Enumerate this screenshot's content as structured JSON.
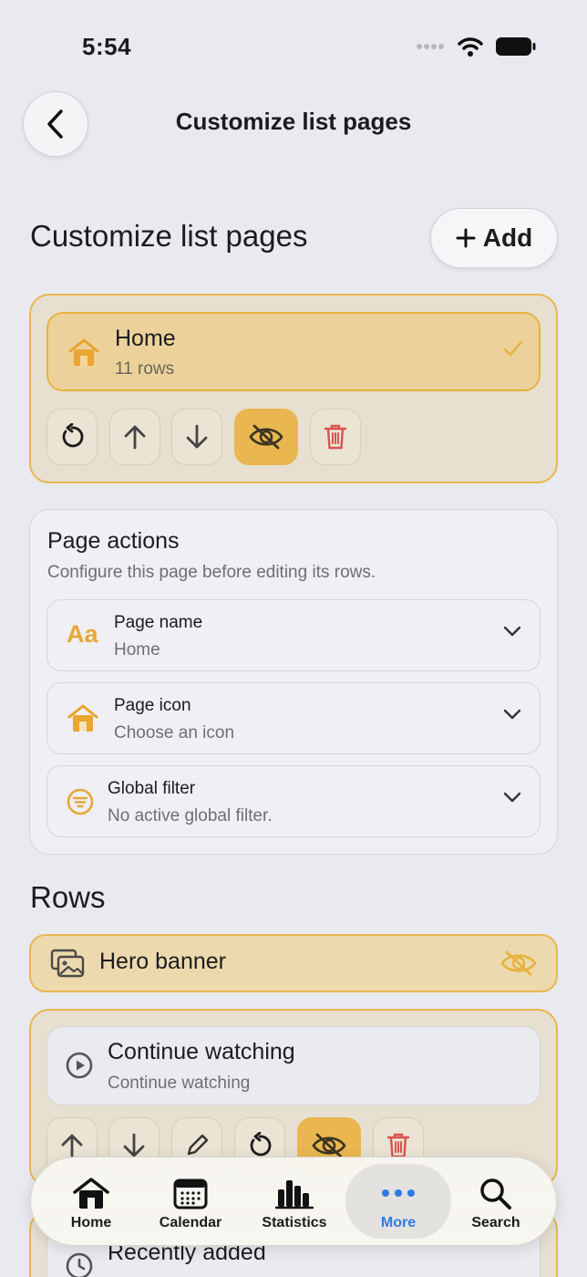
{
  "status_bar": {
    "time": "5:54"
  },
  "header": {
    "back_icon": "chevron-left-icon",
    "title": "Customize list pages"
  },
  "section": {
    "title": "Customize list pages",
    "add_label": "Add"
  },
  "page": {
    "name": "Home",
    "rows_count": "11 rows",
    "icon": "house-icon",
    "selected": true,
    "tools": [
      "reset-icon",
      "arrow-up-icon",
      "arrow-down-icon",
      "eye-slash-icon",
      "trash-icon"
    ],
    "hidden_active": true
  },
  "page_actions": {
    "title": "Page actions",
    "subtitle": "Configure this page before editing its rows.",
    "items": [
      {
        "label": "Page name",
        "value": "Home",
        "icon": "text-aa-icon",
        "icon_text": "Aa"
      },
      {
        "label": "Page icon",
        "value": "Choose an icon",
        "icon": "house-icon"
      },
      {
        "label": "Global filter",
        "value": "No active global filter.",
        "icon": "filter-circle-icon"
      }
    ]
  },
  "rows": {
    "title": "Rows",
    "items": [
      {
        "label": "Hero banner",
        "icon": "photos-icon",
        "hidden": true
      },
      {
        "label": "Continue watching",
        "subtitle": "Continue watching",
        "icon": "play-circle-icon",
        "tools": [
          "arrow-up-icon",
          "arrow-down-icon",
          "pencil-icon",
          "reset-icon",
          "eye-slash-icon",
          "trash-icon"
        ]
      },
      {
        "label": "Recently added",
        "icon": "clock-icon"
      }
    ]
  },
  "tab_bar": {
    "tabs": [
      {
        "label": "Home",
        "icon": "house-icon"
      },
      {
        "label": "Calendar",
        "icon": "calendar-icon"
      },
      {
        "label": "Statistics",
        "icon": "bar-chart-icon"
      },
      {
        "label": "More",
        "icon": "ellipsis-icon",
        "selected": true
      },
      {
        "label": "Search",
        "icon": "magnifier-icon"
      }
    ]
  },
  "colors": {
    "accent": "#e8b23e",
    "selected_tab": "#2f7ae5",
    "danger": "#d9534f"
  }
}
